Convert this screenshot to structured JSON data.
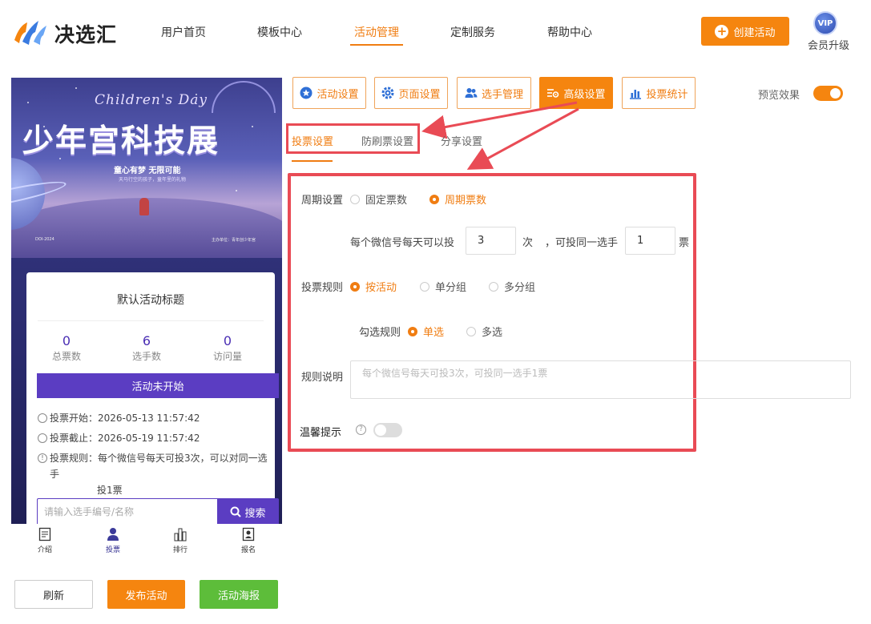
{
  "header": {
    "brand": "决选汇",
    "nav": [
      "用户首页",
      "模板中心",
      "活动管理",
      "定制服务",
      "帮助中心"
    ],
    "active_nav": "活动管理",
    "create_label": "创建活动",
    "vip_badge": "VIP",
    "vip_label": "会员升级"
  },
  "preview": {
    "banner_en": "Children's Day",
    "banner_title": "少年宫科技展",
    "banner_sub": "童心有梦 无限可能",
    "banner_sub2": "天马行空的孩子，童年里的礼物",
    "banner_footer_left": "DOI-2024",
    "banner_footer_right": "主办单位：青年创少年宫",
    "activity_title": "默认活动标题",
    "stats": [
      {
        "value": "0",
        "label": "总票数"
      },
      {
        "value": "6",
        "label": "选手数"
      },
      {
        "value": "0",
        "label": "访问量"
      }
    ],
    "status_button": "活动未开始",
    "vote_start": "投票开始：2026-05-13 11:57:42",
    "vote_end": "投票截止：2026-05-19 11:57:42",
    "vote_rule_line1": "投票规则：每个微信号每天可投3次，可以对同一选手",
    "vote_rule_line2": "投1票",
    "search_placeholder": "请输入选手编号/名称",
    "search_button": "搜索",
    "bottom_nav": [
      "介绍",
      "投票",
      "排行",
      "报名"
    ]
  },
  "footer_buttons": {
    "refresh": "刷新",
    "publish": "发布活动",
    "poster": "活动海报"
  },
  "toolbar": {
    "buttons": [
      "活动设置",
      "页面设置",
      "选手管理",
      "高级设置",
      "投票统计"
    ],
    "active": "高级设置",
    "preview_label": "预览效果",
    "preview_on": true
  },
  "subtabs": {
    "items": [
      "投票设置",
      "防刷票设置",
      "分享设置"
    ],
    "active": "投票设置"
  },
  "form": {
    "period_label": "周期设置",
    "period_options": [
      "固定票数",
      "周期票数"
    ],
    "period_selected": "周期票数",
    "per_day_prefix": "每个微信号每天可以投",
    "per_day_value": "3",
    "per_day_unit": "次",
    "same_player_prefix": "，可投同一选手",
    "same_player_value": "1",
    "same_player_unit": "票",
    "rule_label": "投票规则",
    "rule_options": [
      "按活动",
      "单分组",
      "多分组"
    ],
    "rule_selected": "按活动",
    "check_label": "勾选规则",
    "check_options": [
      "单选",
      "多选"
    ],
    "check_selected": "单选",
    "desc_label": "规则说明",
    "desc_placeholder": "每个微信号每天可投3次，可投同一选手1票",
    "tip_label": "温馨提示",
    "tip_help": "?",
    "tip_on": false
  },
  "colors": {
    "accent": "#f5850f",
    "purple": "#5b3dc2",
    "green": "#5dbd3a",
    "highlight": "#e94b55"
  }
}
